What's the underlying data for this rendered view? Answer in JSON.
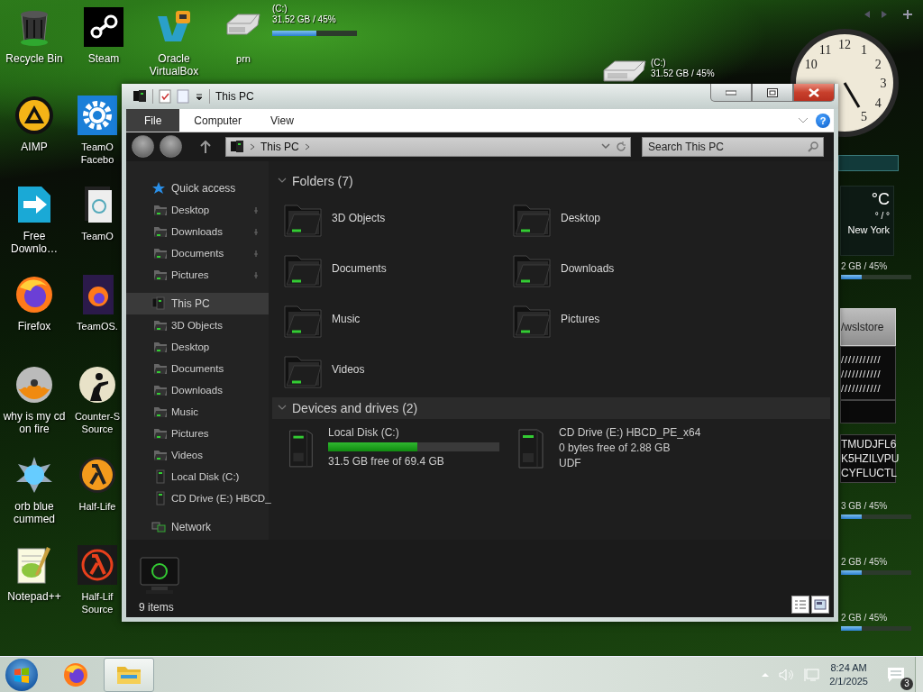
{
  "desktop_icons": [
    {
      "label": "Recycle Bin"
    },
    {
      "label": "Steam"
    },
    {
      "label": "Oracle VirtualBox"
    },
    {
      "label": "prn"
    },
    {
      "label": "AIMP"
    },
    {
      "label": "TeamO Facebo"
    },
    {
      "label": "Free Downlo…"
    },
    {
      "label": "TeamO"
    },
    {
      "label": "Firefox"
    },
    {
      "label": "TeamOS."
    },
    {
      "label": "why is my cd on fire"
    },
    {
      "label": "Counter-S Source"
    },
    {
      "label": "orb blue cummed"
    },
    {
      "label": "Half-Life"
    },
    {
      "label": "Notepad++"
    },
    {
      "label": "Half-Lif Source"
    }
  ],
  "drive_widgets": [
    {
      "drive": "(C:)",
      "usage": "31.52 GB / 45%",
      "level": 0.52
    },
    {
      "drive": "(C:)",
      "usage": "31.52 GB / 45%"
    }
  ],
  "clock": {
    "numerals": [
      "10",
      "11",
      "12",
      "1",
      "2",
      "3",
      "4",
      "5"
    ]
  },
  "weather": {
    "unit": "°C",
    "range": "° / °",
    "city": "New York"
  },
  "store_widget": {
    "path": "/wslstore",
    "hatch_rows": [
      "///////////",
      "///////////",
      "///////////"
    ],
    "codes": [
      "TMUDJFL6",
      "K5HZILVPU",
      "CYFLUCTL"
    ]
  },
  "side_meters": [
    {
      "usage": "2 GB / 45%",
      "level": 0.3
    },
    {
      "usage": "3 GB / 45%",
      "level": 0.3
    },
    {
      "usage": "2 GB / 45%",
      "level": 0.3
    },
    {
      "usage": "2 GB / 45%",
      "level": 0.3
    }
  ],
  "window": {
    "title": "This PC",
    "ribbon_tabs": [
      {
        "label": "File",
        "selected": true
      },
      {
        "label": "Computer",
        "selected": false
      },
      {
        "label": "View",
        "selected": false
      }
    ],
    "help": "?",
    "address": {
      "crumbs": [
        "This PC"
      ]
    },
    "search": {
      "placeholder": "Search This PC"
    },
    "nav_tree": [
      {
        "label": "Quick access",
        "selected": false,
        "children": [
          {
            "label": "Desktop",
            "selected": false,
            "pinned": true
          },
          {
            "label": "Downloads",
            "selected": false,
            "pinned": true
          },
          {
            "label": "Documents",
            "selected": false,
            "pinned": true
          },
          {
            "label": "Pictures",
            "selected": false,
            "pinned": true
          }
        ]
      },
      {
        "label": "This PC",
        "selected": true,
        "children": [
          {
            "label": "3D Objects",
            "selected": false
          },
          {
            "label": "Desktop",
            "selected": false
          },
          {
            "label": "Documents",
            "selected": false
          },
          {
            "label": "Downloads",
            "selected": false
          },
          {
            "label": "Music",
            "selected": false
          },
          {
            "label": "Pictures",
            "selected": false
          },
          {
            "label": "Videos",
            "selected": false
          },
          {
            "label": "Local Disk (C:)",
            "selected": false
          },
          {
            "label": "CD Drive (E:) HBCD_",
            "selected": false
          }
        ]
      },
      {
        "label": "Network",
        "selected": false
      }
    ],
    "sections": [
      {
        "kind": "folders",
        "title": "Folders (7)",
        "items": [
          {
            "name": "3D Objects"
          },
          {
            "name": "Desktop"
          },
          {
            "name": "Documents"
          },
          {
            "name": "Downloads"
          },
          {
            "name": "Music"
          },
          {
            "name": "Pictures"
          },
          {
            "name": "Videos"
          }
        ]
      },
      {
        "kind": "drives",
        "title": "Devices and drives (2)",
        "items": [
          {
            "name": "Local Disk (C:)",
            "level": 0.52,
            "details": [
              "31.5 GB free of 69.4 GB"
            ]
          },
          {
            "name": "CD Drive (E:) HBCD_PE_x64",
            "details": [
              "0 bytes free of 2.88 GB",
              "UDF"
            ]
          }
        ]
      }
    ],
    "status": "9 items"
  },
  "taskbar": {
    "buttons": [
      {
        "selected": false
      },
      {
        "selected": true
      }
    ],
    "time": "8:24 AM",
    "date": "2/1/2025",
    "notifications": "3"
  }
}
